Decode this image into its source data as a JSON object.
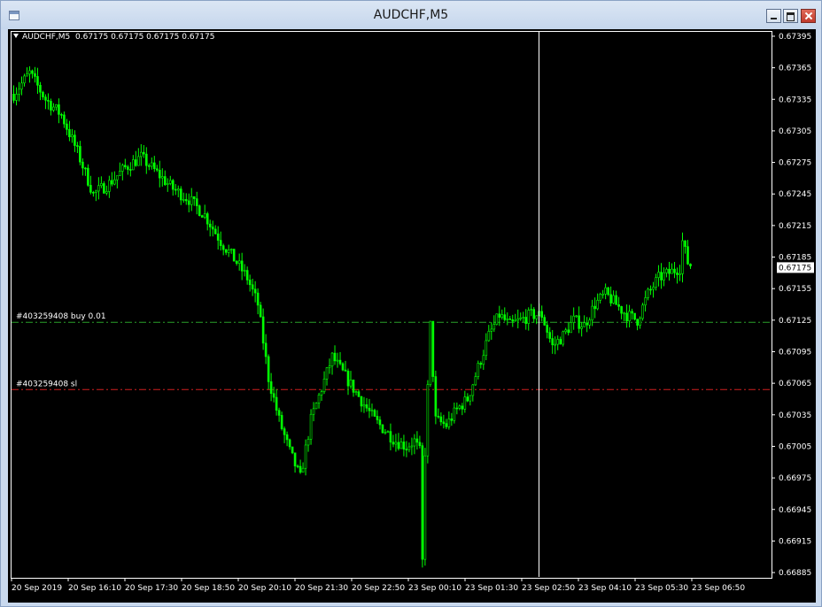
{
  "window": {
    "title": "AUDCHF,M5"
  },
  "chart_header": {
    "symbol": "AUDCHF,M5",
    "ohlc": "0.67175 0.67175 0.67175 0.67175"
  },
  "orders": [
    {
      "label": "#403259408 buy 0.01",
      "price": 0.67123,
      "color": "#2aa02a"
    },
    {
      "label": "#403259408 sl",
      "price": 0.67059,
      "color": "#d01f1f"
    }
  ],
  "colors": {
    "background": "#000000",
    "candle": "#00ff00",
    "crosshair": "#ffffff",
    "foreground": "#ffffff"
  },
  "chart_data": {
    "type": "candlestick",
    "y_ticks": [
      "0.67395",
      "0.67365",
      "0.67335",
      "0.67305",
      "0.67275",
      "0.67245",
      "0.67215",
      "0.67185",
      "0.67155",
      "0.67125",
      "0.67095",
      "0.67065",
      "0.67035",
      "0.67005",
      "0.66975",
      "0.66945",
      "0.66915",
      "0.66885"
    ],
    "x_ticks": [
      "20 Sep 2019",
      "20 Sep 16:10",
      "20 Sep 17:30",
      "20 Sep 18:50",
      "20 Sep 20:10",
      "20 Sep 21:30",
      "20 Sep 22:50",
      "23 Sep 00:10",
      "23 Sep 01:30",
      "23 Sep 02:50",
      "23 Sep 04:10",
      "23 Sep 05:30",
      "23 Sep 06:50"
    ],
    "current_price": "0.67175",
    "ylim": [
      0.6688,
      0.674
    ],
    "path": [
      [
        0.6734,
        0
      ],
      [
        0.6736,
        6
      ],
      [
        0.67335,
        12
      ],
      [
        0.6732,
        18
      ],
      [
        0.67285,
        24
      ],
      [
        0.67245,
        30
      ],
      [
        0.67255,
        36
      ],
      [
        0.6727,
        42
      ],
      [
        0.6728,
        48
      ],
      [
        0.67265,
        54
      ],
      [
        0.6725,
        60
      ],
      [
        0.6724,
        66
      ],
      [
        0.67225,
        72
      ],
      [
        0.672,
        78
      ],
      [
        0.6718,
        84
      ],
      [
        0.67165,
        88
      ],
      [
        0.6714,
        92
      ],
      [
        0.6707,
        96
      ],
      [
        0.6703,
        100
      ],
      [
        0.67,
        104
      ],
      [
        0.66975,
        108
      ],
      [
        0.6703,
        112
      ],
      [
        0.6706,
        116
      ],
      [
        0.6709,
        120
      ],
      [
        0.67075,
        124
      ],
      [
        0.6706,
        128
      ],
      [
        0.67045,
        132
      ],
      [
        0.6703,
        136
      ],
      [
        0.6702,
        140
      ],
      [
        0.6701,
        144
      ],
      [
        0.67005,
        148
      ],
      [
        0.6701,
        151
      ],
      [
        0.67,
        153
      ],
      [
        0.66895,
        154
      ],
      [
        0.67,
        155
      ],
      [
        0.6712,
        157
      ],
      [
        0.6703,
        159
      ],
      [
        0.67025,
        163
      ],
      [
        0.6704,
        167
      ],
      [
        0.6705,
        171
      ],
      [
        0.6708,
        175
      ],
      [
        0.6711,
        179
      ],
      [
        0.6713,
        183
      ],
      [
        0.6712,
        187
      ],
      [
        0.67125,
        191
      ],
      [
        0.6713,
        195
      ],
      [
        0.6713,
        199
      ],
      [
        0.671,
        203
      ],
      [
        0.6711,
        207
      ],
      [
        0.67125,
        211
      ],
      [
        0.6712,
        215
      ],
      [
        0.6714,
        219
      ],
      [
        0.6715,
        223
      ],
      [
        0.6714,
        227
      ],
      [
        0.6713,
        231
      ],
      [
        0.67125,
        235
      ],
      [
        0.6715,
        239
      ],
      [
        0.67165,
        243
      ],
      [
        0.6717,
        247
      ],
      [
        0.67175,
        251
      ],
      [
        0.672,
        252
      ],
      [
        0.6718,
        254
      ],
      [
        0.67175,
        256
      ]
    ]
  }
}
